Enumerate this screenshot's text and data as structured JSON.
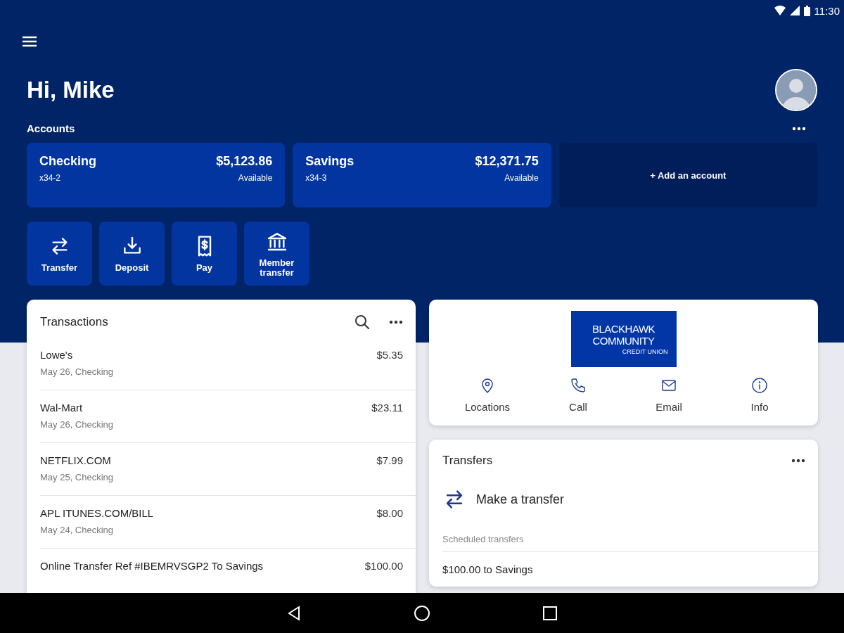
{
  "status_bar": {
    "time": "11:30"
  },
  "greeting": "Hi, Mike",
  "accounts": {
    "title": "Accounts",
    "add_label": "+ Add an account",
    "items": [
      {
        "name": "Checking",
        "number": "x34-2",
        "balance": "$5,123.86",
        "balance_label": "Available"
      },
      {
        "name": "Savings",
        "number": "x34-3",
        "balance": "$12,371.75",
        "balance_label": "Available"
      }
    ]
  },
  "quick_actions": [
    {
      "label": "Transfer",
      "kind": "transfer"
    },
    {
      "label": "Deposit",
      "kind": "deposit"
    },
    {
      "label": "Pay",
      "kind": "bill"
    },
    {
      "label": "Member transfer",
      "kind": "bank"
    }
  ],
  "transactions": {
    "title": "Transactions",
    "rows": [
      {
        "merchant": "Lowe's",
        "detail": "May 26, Checking",
        "amount": "$5.35"
      },
      {
        "merchant": "Wal-Mart",
        "detail": "May 26, Checking",
        "amount": "$23.11"
      },
      {
        "merchant": "NETFLIX.COM",
        "detail": "May 25, Checking",
        "amount": "$7.99"
      },
      {
        "merchant": "APL ITUNES.COM/BILL",
        "detail": "May 24, Checking",
        "amount": "$8.00"
      },
      {
        "merchant": "Online Transfer Ref #IBEMRVSGP2 To Savings",
        "amount": "$100.00"
      }
    ]
  },
  "institution": {
    "logo_lines": [
      "BLACKHAWK",
      "COMMUNITY",
      "CREDIT UNION"
    ],
    "actions": [
      {
        "label": "Locations",
        "kind": "pin"
      },
      {
        "label": "Call",
        "kind": "phone"
      },
      {
        "label": "Email",
        "kind": "mail"
      },
      {
        "label": "Info",
        "kind": "info"
      }
    ]
  },
  "transfers": {
    "title": "Transfers",
    "action": "Make a transfer",
    "section": "Scheduled transfers",
    "items": [
      "$100.00 to Savings"
    ]
  }
}
